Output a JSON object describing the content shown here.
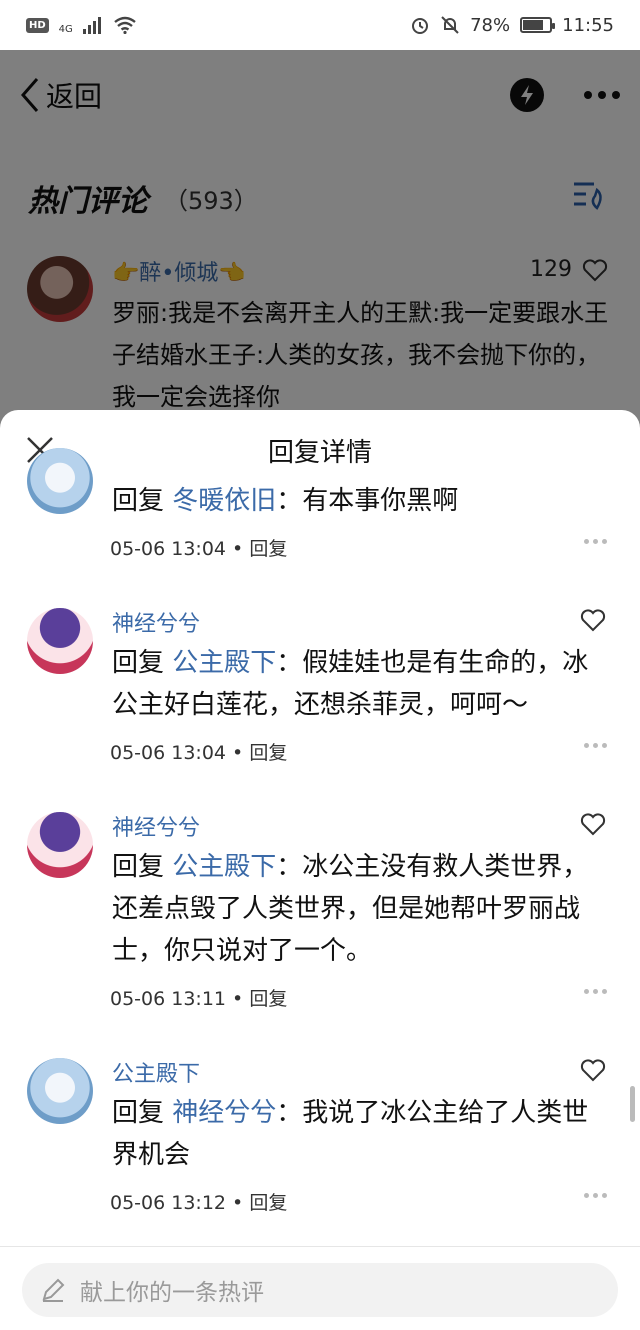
{
  "status_bar": {
    "hd": "HD",
    "network": "4G",
    "battery_percent": "78%",
    "battery_level": 0.78,
    "time": "11:55"
  },
  "background_page": {
    "back_label": "返回",
    "hot_comments_title": "热门评论",
    "hot_comments_count": "（593）",
    "top_comment": {
      "author": "👉醉•倾城👈",
      "likes": "129",
      "text": "罗丽:我是不会离开主人的王默:我一定要跟水王子结婚水王子:人类的女孩，我不会抛下你的，我一定会选择你"
    }
  },
  "sheet": {
    "title": "回复详情",
    "replies": [
      {
        "author": "",
        "prefix": "回复 ",
        "reply_to": "冬暖依旧",
        "content": "：有本事你黑啊",
        "time": "05-06 13:04",
        "reply_label": "回复"
      },
      {
        "author": "神经兮兮",
        "prefix": "回复 ",
        "reply_to": "公主殿下",
        "content": "：假娃娃也是有生命的，冰公主好白莲花，还想杀菲灵，呵呵～",
        "time": "05-06 13:04",
        "reply_label": "回复"
      },
      {
        "author": "神经兮兮",
        "prefix": "回复 ",
        "reply_to": "公主殿下",
        "content": "：冰公主没有救人类世界，还差点毁了人类世界，但是她帮叶罗丽战士，你只说对了一个。",
        "time": "05-06 13:11",
        "reply_label": "回复"
      },
      {
        "author": "公主殿下",
        "prefix": "回复 ",
        "reply_to": "神经兮兮",
        "content": "：我说了冰公主给了人类世界机会",
        "time": "05-06 13:12",
        "reply_label": "回复"
      }
    ],
    "input_placeholder": "献上你的一条热评"
  },
  "colors": {
    "link_blue": "#3b6aa8",
    "overlay": "rgba(0,0,0,0.5)"
  }
}
